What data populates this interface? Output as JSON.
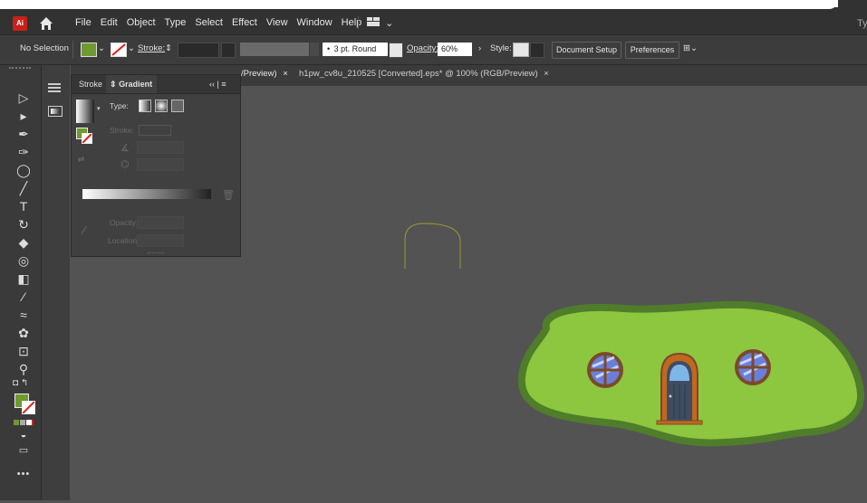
{
  "app": {
    "logo_text": "Ai",
    "menu": [
      "File",
      "Edit",
      "Object",
      "Type",
      "Select",
      "Effect",
      "View",
      "Window",
      "Help"
    ],
    "right_clip_text": "Ty"
  },
  "control_bar": {
    "selection_label": "No Selection",
    "fill_color": "#6e9a2f",
    "stroke_label": "Stroke:",
    "brush_value": "3 pt. Round",
    "opacity_label": "Opacity:",
    "opacity_value": "60%",
    "style_label": "Style:",
    "document_setup": "Document Setup",
    "preferences": "Preferences"
  },
  "tabs": [
    {
      "label": "/Preview)",
      "close": "×"
    },
    {
      "label": "h1pw_cv8u_210525 [Converted].eps* @ 100% (RGB/Preview)",
      "close": "×"
    }
  ],
  "panel": {
    "tab_stroke": "Stroke",
    "tab_gradient": "Gradient",
    "type_label": "Type:",
    "stroke_label": "Stroke:",
    "opacity_label": "Opacity:",
    "location_label": "Location:"
  },
  "colors": {
    "accent_fill": "#6e9a2f",
    "hill_green": "#8dc63f",
    "hill_stroke": "#4f7d2a"
  }
}
